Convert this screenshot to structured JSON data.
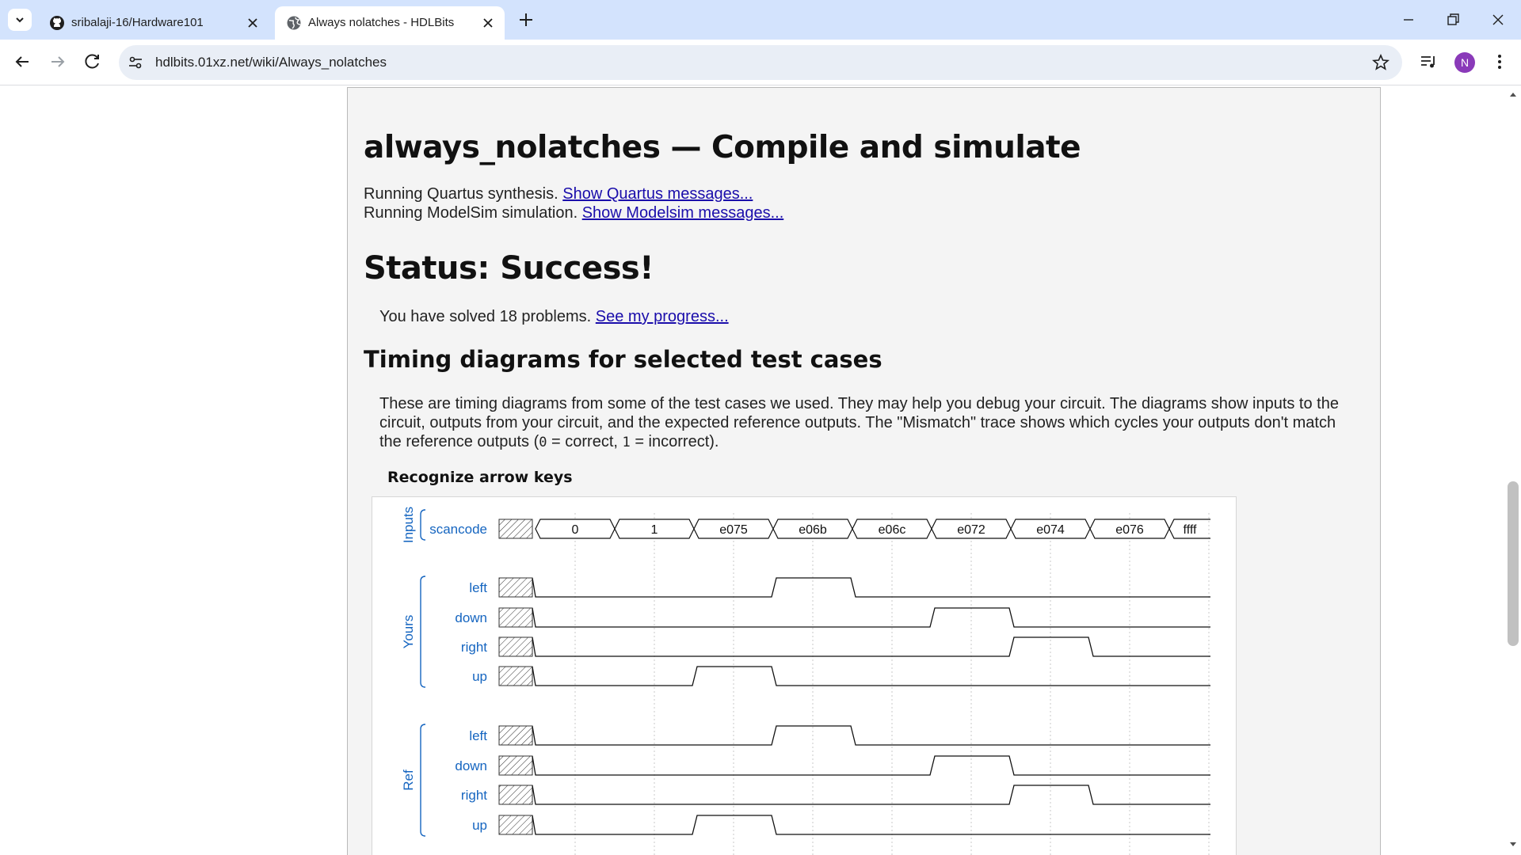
{
  "browser": {
    "tabs": [
      {
        "title": "sribalaji-16/Hardware101",
        "active": false,
        "icon": "github-icon"
      },
      {
        "title": "Always nolatches - HDLBits",
        "active": true,
        "icon": "globe-icon"
      }
    ],
    "url": "hdlbits.01xz.net/wiki/Always_nolatches",
    "profile_initial": "N",
    "profile_color": "#8a3ab9"
  },
  "page": {
    "title": "always_nolatches — Compile and simulate",
    "quartus_text": "Running Quartus synthesis.",
    "quartus_link": "Show Quartus messages...",
    "modelsim_text": "Running ModelSim simulation.",
    "modelsim_link": "Show Modelsim messages...",
    "status": "Status: Success!",
    "solved_text": "You have solved 18 problems.",
    "progress_link": "See my progress...",
    "timing_title": "Timing diagrams for selected test cases",
    "description_before": "These are timing diagrams from some of the test cases we used. They may help you debug your circuit. The diagrams show inputs to the circuit, outputs from your circuit, and the expected reference outputs. The \"Mismatch\" trace shows which cycles your outputs don't match the reference outputs (",
    "code_zero": "0",
    "description_middle1": " = correct, ",
    "code_one": "1",
    "description_middle2": " = incorrect).",
    "test_case_title": "Recognize arrow keys"
  },
  "waveform": {
    "group_labels": {
      "inputs": "Inputs",
      "yours": "Yours",
      "ref": "Ref"
    },
    "signal_color": "#1565c0",
    "input_signal": {
      "name": "scancode",
      "values": [
        "0",
        "1",
        "e075",
        "e06b",
        "e06c",
        "e072",
        "e074",
        "e076",
        "ffff"
      ]
    },
    "yours": [
      {
        "name": "left",
        "high_cycles": [
          3
        ]
      },
      {
        "name": "down",
        "high_cycles": [
          5
        ]
      },
      {
        "name": "right",
        "high_cycles": [
          6
        ]
      },
      {
        "name": "up",
        "high_cycles": [
          2
        ]
      }
    ],
    "ref": [
      {
        "name": "left",
        "high_cycles": [
          3
        ]
      },
      {
        "name": "down",
        "high_cycles": [
          5
        ]
      },
      {
        "name": "right",
        "high_cycles": [
          6
        ]
      },
      {
        "name": "up",
        "high_cycles": [
          2
        ]
      }
    ]
  }
}
